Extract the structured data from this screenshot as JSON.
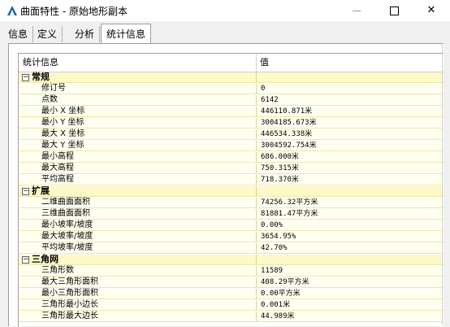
{
  "window": {
    "title": "曲面特性 - 原始地形副本",
    "icon": "app-a-icon",
    "accent": "#1e5fb4",
    "minimize": "—",
    "maximize": "☐",
    "close": "✕"
  },
  "tabs": [
    {
      "label": "信息"
    },
    {
      "label": "定义"
    },
    {
      "label": "分析"
    },
    {
      "label": "统计信息"
    }
  ],
  "grid": {
    "columns": {
      "name": "统计信息",
      "value": "值"
    },
    "expander_symbol": "−",
    "groups": [
      {
        "label": "常规",
        "rows": [
          {
            "name": "修订号",
            "value": "0"
          },
          {
            "name": "点数",
            "value": "6142"
          },
          {
            "name": "最小 X 坐标",
            "value": "446110.871米"
          },
          {
            "name": "最小 Y 坐标",
            "value": "3004185.673米"
          },
          {
            "name": "最大 X 坐标",
            "value": "446534.338米"
          },
          {
            "name": "最大 Y 坐标",
            "value": "3004592.754米"
          },
          {
            "name": "最小高程",
            "value": "686.000米"
          },
          {
            "name": "最大高程",
            "value": "750.315米"
          },
          {
            "name": "平均高程",
            "value": "718.370米"
          }
        ]
      },
      {
        "label": "扩展",
        "rows": [
          {
            "name": "二维曲面面积",
            "value": "74256.32平方米"
          },
          {
            "name": "三维曲面面积",
            "value": "81881.47平方米"
          },
          {
            "name": "最小坡率/坡度",
            "value": "0.00%"
          },
          {
            "name": "最大坡率/坡度",
            "value": "3654.95%"
          },
          {
            "name": "平均坡率/坡度",
            "value": "42.70%"
          }
        ]
      },
      {
        "label": "三角网",
        "rows": [
          {
            "name": "三角形数",
            "value": "11589"
          },
          {
            "name": "最大三角形面积",
            "value": "408.29平方米"
          },
          {
            "name": "最小三角形面积",
            "value": "0.00平方米"
          },
          {
            "name": "三角形最小边长",
            "value": "0.001米"
          },
          {
            "name": "三角形最大边长",
            "value": "44.989米"
          }
        ]
      }
    ]
  }
}
